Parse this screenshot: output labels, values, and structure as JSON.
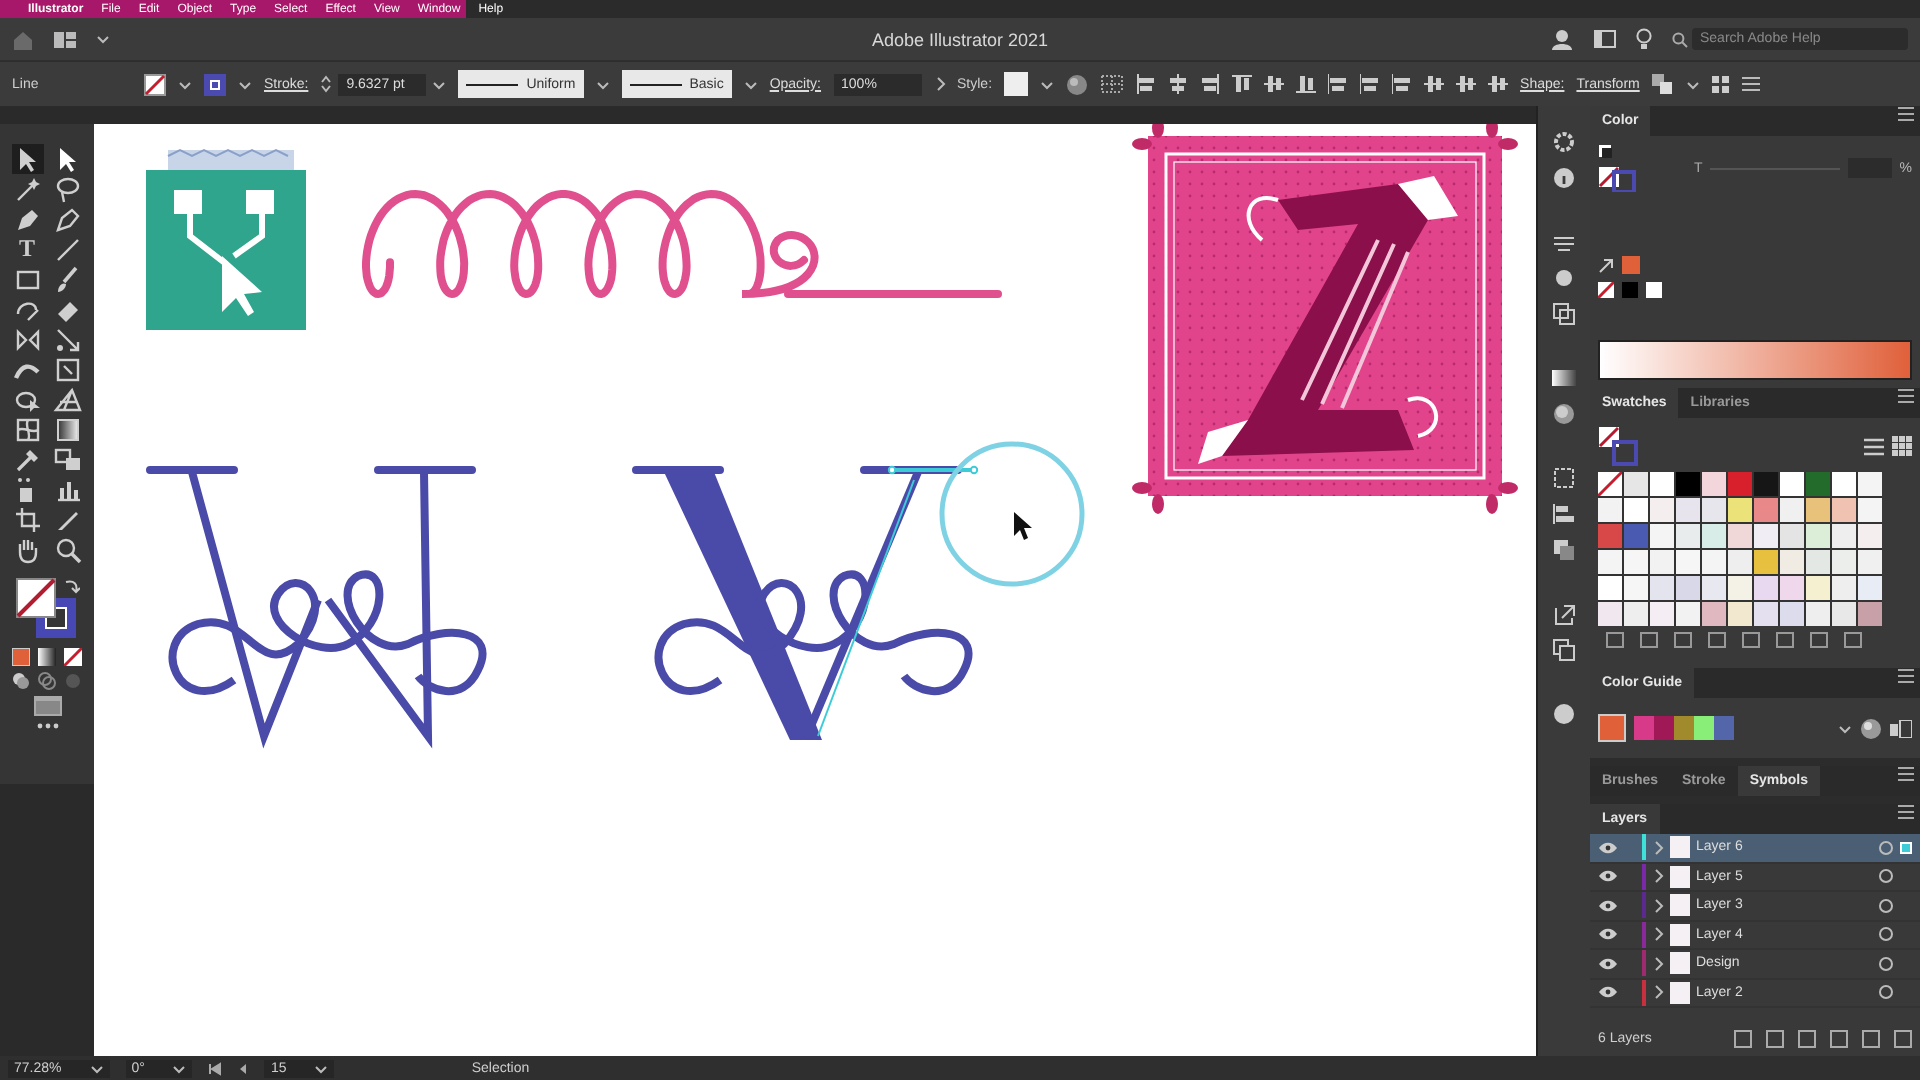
{
  "menu_bar": {
    "app": "Illustrator",
    "items": [
      "File",
      "Edit",
      "Object",
      "Type",
      "Select",
      "Effect",
      "View",
      "Window",
      "Help"
    ]
  },
  "app_bar": {
    "title": "Adobe Illustrator 2021",
    "search": {
      "placeholder": "Search Adobe Help"
    }
  },
  "control_bar": {
    "selection_type": "Line",
    "stroke_label": "Stroke:",
    "stroke_weight": "9.6327 pt",
    "profile": "Uniform",
    "brush": "Basic",
    "opacity_label": "Opacity:",
    "opacity": "100%",
    "style_label": "Style:",
    "shape_label": "Shape:",
    "transform_label": "Transform"
  },
  "toolbar": {
    "type_tool_glyph": "T"
  },
  "color_panel": {
    "tab": "Color",
    "slider_label": "T",
    "unit": "%"
  },
  "swatches_panel": {
    "tabs": [
      {
        "label": "Swatches",
        "selected": true
      },
      {
        "label": "Libraries",
        "selected": false
      }
    ],
    "swatches": [
      {
        "kind": "none"
      },
      {
        "kind": "color",
        "color": "#e6e6e6"
      },
      {
        "kind": "color",
        "color": "#ffffff"
      },
      {
        "kind": "color",
        "color": "#000000"
      },
      {
        "kind": "color",
        "color": "#f2d6dc"
      },
      {
        "kind": "color",
        "color": "#d8202c"
      },
      {
        "kind": "color",
        "color": "#161616"
      },
      {
        "kind": "color",
        "color": "#ffffff"
      },
      {
        "kind": "color",
        "color": "#236b2b"
      },
      {
        "kind": "color",
        "color": "#ffffff"
      },
      {
        "kind": "color",
        "color": "#f4f4f4"
      },
      {
        "kind": "color",
        "color": "#f2f2f2"
      },
      {
        "kind": "color",
        "color": "#ffffff"
      },
      {
        "kind": "color",
        "color": "#f4eeee"
      },
      {
        "kind": "color",
        "color": "#e8e4ee"
      },
      {
        "kind": "color",
        "color": "#e6e6ec"
      },
      {
        "kind": "color",
        "color": "#ece27a"
      },
      {
        "kind": "color",
        "color": "#e88888"
      },
      {
        "kind": "color",
        "color": "#f0f0f0"
      },
      {
        "kind": "color",
        "color": "#e8c27a"
      },
      {
        "kind": "color",
        "color": "#f0c2b2"
      },
      {
        "kind": "color",
        "color": "#f4f4f4"
      },
      {
        "kind": "color",
        "color": "#d84848"
      },
      {
        "kind": "color",
        "color": "#4a5ab0"
      },
      {
        "kind": "color",
        "color": "#f4f4f4"
      },
      {
        "kind": "color",
        "color": "#e8ecec"
      },
      {
        "kind": "color",
        "color": "#d8ece8"
      },
      {
        "kind": "color",
        "color": "#f0d8d8"
      },
      {
        "kind": "color",
        "color": "#f0eef4"
      },
      {
        "kind": "color",
        "color": "#e4e4e4"
      },
      {
        "kind": "color",
        "color": "#dceed8"
      },
      {
        "kind": "color",
        "color": "#eeeeee"
      },
      {
        "kind": "color",
        "color": "#f4eeee"
      },
      {
        "kind": "color",
        "color": "#f4f4f4"
      },
      {
        "kind": "color",
        "color": "#f6f6f6"
      },
      {
        "kind": "color",
        "color": "#f2f2f2"
      },
      {
        "kind": "color",
        "color": "#f6f6f6"
      },
      {
        "kind": "color",
        "color": "#f4f4f4"
      },
      {
        "kind": "color",
        "color": "#eeeeee"
      },
      {
        "kind": "color",
        "color": "#e8c040"
      },
      {
        "kind": "color",
        "color": "#f0ece4"
      },
      {
        "kind": "color",
        "color": "#e4e8e4"
      },
      {
        "kind": "color",
        "color": "#eceeec"
      },
      {
        "kind": "color",
        "color": "#f0f0f0"
      },
      {
        "kind": "color",
        "color": "#ffffff"
      },
      {
        "kind": "color",
        "color": "#f6f6f6"
      },
      {
        "kind": "color",
        "color": "#e4e4ee"
      },
      {
        "kind": "color",
        "color": "#d8d8e8"
      },
      {
        "kind": "color",
        "color": "#e8e8f0"
      },
      {
        "kind": "color",
        "color": "#f4f2e6"
      },
      {
        "kind": "color",
        "color": "#e8d8f0"
      },
      {
        "kind": "color",
        "color": "#f0d8ec"
      },
      {
        "kind": "color",
        "color": "#f4f0d0"
      },
      {
        "kind": "color",
        "color": "#eeeeee"
      },
      {
        "kind": "color",
        "color": "#e8ecf4"
      },
      {
        "kind": "color",
        "color": "#f0e8ee"
      },
      {
        "kind": "color",
        "color": "#eeeeee"
      },
      {
        "kind": "color",
        "color": "#f4eef4"
      },
      {
        "kind": "color",
        "color": "#f2f2f2"
      },
      {
        "kind": "color",
        "color": "#e0b8c0"
      },
      {
        "kind": "color",
        "color": "#f2e8d0"
      },
      {
        "kind": "color",
        "color": "#e4e0f0"
      },
      {
        "kind": "color",
        "color": "#dcdcec"
      },
      {
        "kind": "color",
        "color": "#eeeeee"
      },
      {
        "kind": "color",
        "color": "#e8e8e8"
      },
      {
        "kind": "color",
        "color": "#c8a0a8"
      }
    ]
  },
  "color_guide": {
    "tab": "Color Guide",
    "harmony": [
      {
        "kind": "base",
        "color": "#e0603a"
      },
      {
        "kind": "variant",
        "color": "#d83a8a"
      },
      {
        "kind": "variant",
        "color": "#a01856"
      },
      {
        "kind": "variant",
        "color": "#a08a2c"
      },
      {
        "kind": "variant",
        "color": "#88ee78"
      },
      {
        "kind": "variant",
        "color": "#5466aa"
      }
    ]
  },
  "lower_tabs": [
    {
      "label": "Brushes",
      "selected": false
    },
    {
      "label": "Stroke",
      "selected": false
    },
    {
      "label": "Symbols",
      "selected": true
    }
  ],
  "layers_panel": {
    "tab": "Layers",
    "layers": [
      {
        "name": "Layer 6",
        "color": "#3ee0d8",
        "selected": true
      },
      {
        "name": "Layer 5",
        "color": "#7a2aa8",
        "selected": false
      },
      {
        "name": "Layer 3",
        "color": "#5a2a90",
        "selected": false
      },
      {
        "name": "Layer 4",
        "color": "#8a2a9a",
        "selected": false
      },
      {
        "name": "Design",
        "color": "#a02a70",
        "selected": false
      },
      {
        "name": "Layer 2",
        "color": "#c83040",
        "selected": false
      }
    ],
    "count": "6 Layers"
  },
  "status_bar": {
    "zoom": "77.28%",
    "rotation": "0°",
    "artboard": "15",
    "tool": "Selection"
  }
}
